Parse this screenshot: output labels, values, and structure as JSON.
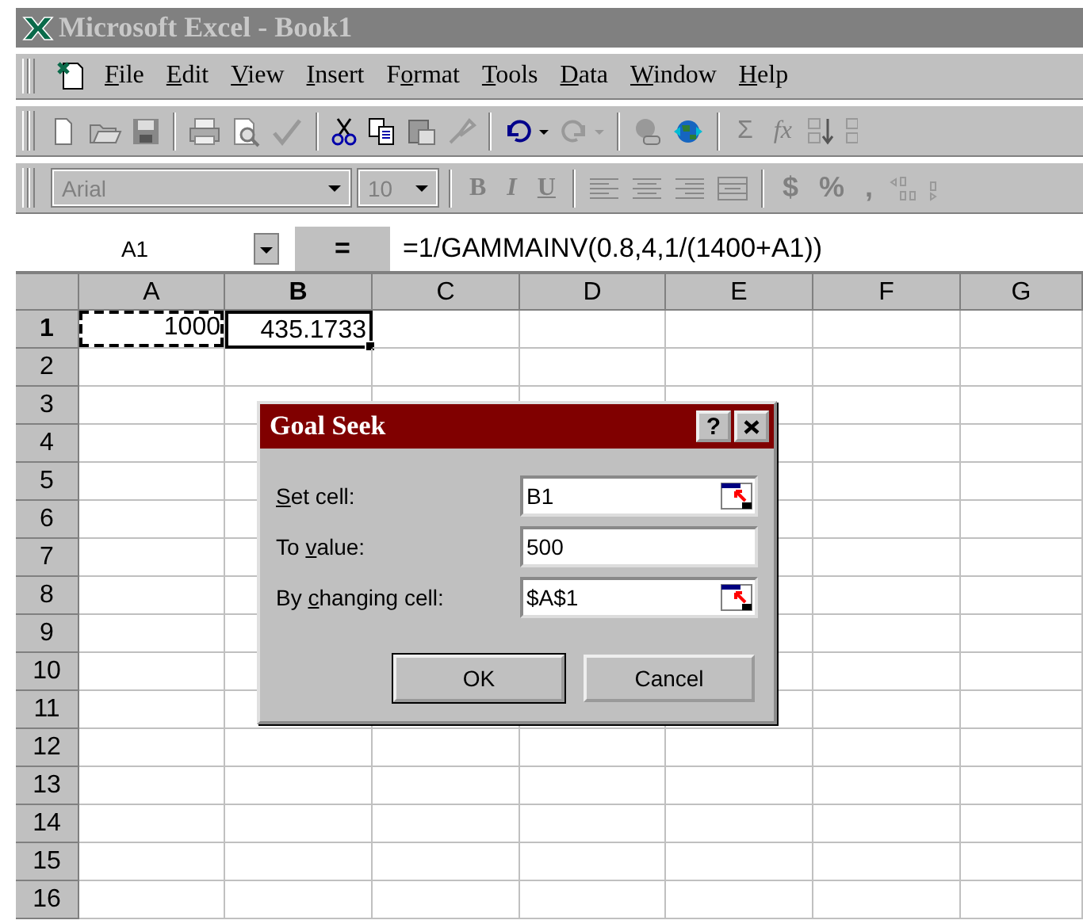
{
  "window": {
    "title": "Microsoft Excel - Book1"
  },
  "menu": [
    {
      "key": "F",
      "post": "ile"
    },
    {
      "key": "E",
      "post": "dit"
    },
    {
      "key": "V",
      "post": "iew"
    },
    {
      "key": "I",
      "post": "nsert"
    },
    {
      "pre": "F",
      "key": "o",
      "post": "rmat"
    },
    {
      "key": "T",
      "post": "ools"
    },
    {
      "key": "D",
      "post": "ata"
    },
    {
      "key": "W",
      "post": "indow"
    },
    {
      "key": "H",
      "post": "elp"
    }
  ],
  "standard_toolbar": {
    "sum": "Σ",
    "function": "fx"
  },
  "formatting_toolbar": {
    "font": "Arial",
    "size": "10",
    "styles": [
      "B",
      "I",
      "U"
    ],
    "number_formats": [
      "$",
      "%",
      ","
    ]
  },
  "formula_bar": {
    "name_box": "A1",
    "equals": "=",
    "formula": "=1/GAMMAINV(0.8,4,1/(1400+A1))"
  },
  "sheet": {
    "columns": [
      {
        "label": "A",
        "selected": false
      },
      {
        "label": "B",
        "selected": true
      },
      {
        "label": "C",
        "selected": false
      },
      {
        "label": "D",
        "selected": false
      },
      {
        "label": "E",
        "selected": false
      },
      {
        "label": "F",
        "selected": false
      },
      {
        "label": "G",
        "selected": false
      }
    ],
    "rows": [
      {
        "label": "1",
        "selected": true,
        "cells": [
          {
            "value": "1000",
            "copied": true,
            "active": false
          },
          {
            "value": "435.1733",
            "copied": false,
            "active": true
          }
        ]
      },
      {
        "label": "2",
        "selected": false
      },
      {
        "label": "3",
        "selected": false
      },
      {
        "label": "4",
        "selected": false
      },
      {
        "label": "5",
        "selected": false
      },
      {
        "label": "6",
        "selected": false
      },
      {
        "label": "7",
        "selected": false
      },
      {
        "label": "8",
        "selected": false
      },
      {
        "label": "9",
        "selected": false
      },
      {
        "label": "10",
        "selected": false
      },
      {
        "label": "11",
        "selected": false
      },
      {
        "label": "12",
        "selected": false
      },
      {
        "label": "13",
        "selected": false
      },
      {
        "label": "14",
        "selected": false
      },
      {
        "label": "15",
        "selected": false
      },
      {
        "label": "16",
        "selected": false
      }
    ]
  },
  "dialog": {
    "title": "Goal Seek",
    "help": "?",
    "fields": [
      {
        "kind": "reference",
        "label": {
          "key": "S",
          "post": "et cell:"
        },
        "value": "B1"
      },
      {
        "kind": "plain",
        "label": {
          "pre": "To ",
          "key": "v",
          "post": "alue:"
        },
        "value": "500"
      },
      {
        "kind": "reference",
        "label": {
          "pre": "By ",
          "key": "c",
          "post": "hanging cell:"
        },
        "value": "$A$1"
      }
    ],
    "buttons": [
      {
        "label": "OK",
        "default": true
      },
      {
        "label": "Cancel",
        "default": false
      }
    ]
  }
}
